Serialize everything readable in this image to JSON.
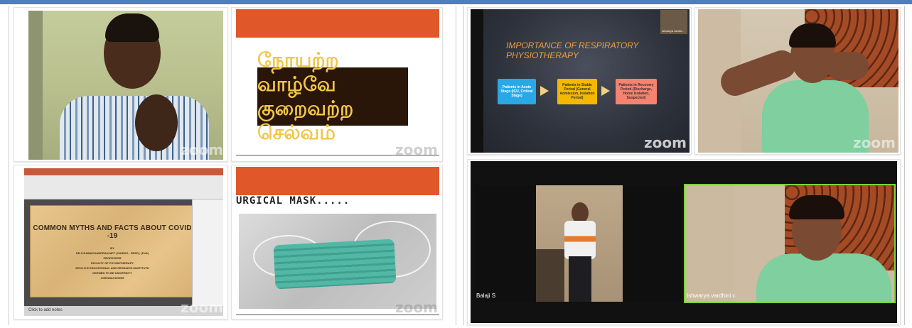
{
  "watermark": "zoom",
  "left_panel": {
    "tamil_slide": {
      "line1": "நோயற்ற வாழ்வே",
      "line2": "குறைவற்ற செல்வம்"
    },
    "ppt_slide": {
      "title": "COMMON MYTHS AND FACTS ABOUT COVID -19",
      "by": "BY",
      "author": "DR.S.RAMACHANDRAN MPT (CARDIO - RESP), (PhD)",
      "role": "PROFESSOR",
      "faculty": "FACULTY OF PHYSIOTHERAPY",
      "institute": "DR M.G.R EDUCATIONAL AND RESEARCH INSTITUTE",
      "deemed": "DEEMED TO BE UNIVERSITY",
      "city": "CHENNAI 600095",
      "notes_hint": "Click to add notes"
    },
    "mask_slide": {
      "title": "URGICAL MASK....."
    }
  },
  "right_panel": {
    "resp_slide": {
      "title_line1": "IMPORTANCE OF RESPIRATORY",
      "title_line2": "PHYSIOTHERAPY",
      "box1": "Patients in Acute Stage (ICU, Critical Stage)",
      "box2": "Patients in Stable Period (General Admission, Isolation Period)",
      "box3": "Patients in Recovery Period (Discharge, Home Isolation, Suspected)",
      "thumb_name": "Ishwarya vardhi..."
    },
    "gallery": {
      "participant1": "Balaji S",
      "participant2": "Ishwarya vardhini c"
    }
  },
  "colors": {
    "accent_bar": "#4a7fc0",
    "slide_orange": "#e0572a",
    "box_blue": "#29a8e6",
    "box_yellow": "#f5b800",
    "box_salmon": "#f5836f",
    "speaker_border": "#7dd33a"
  }
}
